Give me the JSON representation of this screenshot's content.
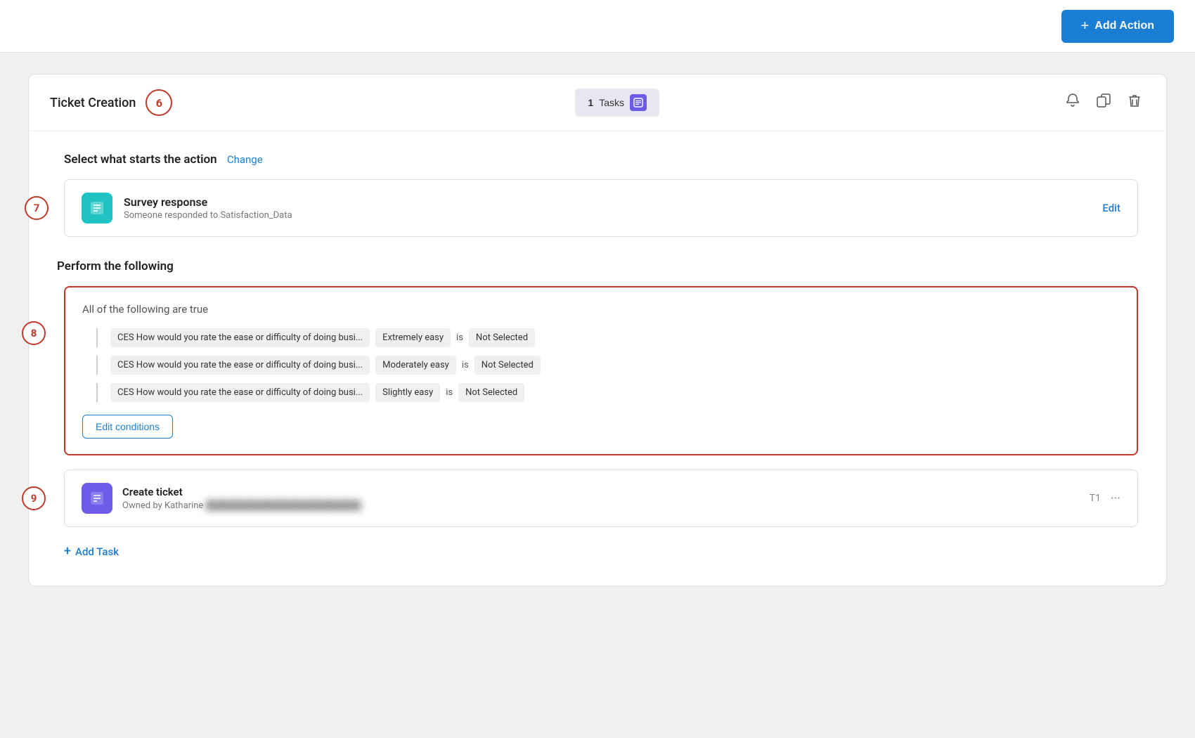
{
  "topbar": {
    "add_action_label": "Add Action"
  },
  "card": {
    "title": "Ticket Creation",
    "step_number": "6",
    "tasks_count": "1",
    "tasks_label": "Tasks"
  },
  "trigger_section": {
    "label": "Select what starts the action",
    "change_link": "Change",
    "trigger_name": "Survey response",
    "trigger_desc": "Someone responded to Satisfaction_Data",
    "edit_link": "Edit",
    "step_number": "7"
  },
  "perform_section": {
    "label": "Perform the following",
    "conditions_header": "All of the following are true",
    "step_number": "8",
    "conditions": [
      {
        "field": "CES How would you rate the ease or difficulty of doing busi...",
        "value": "Extremely easy",
        "op": "is",
        "status": "Not Selected"
      },
      {
        "field": "CES How would you rate the ease or difficulty of doing busi...",
        "value": "Moderately easy",
        "op": "is",
        "status": "Not Selected"
      },
      {
        "field": "CES How would you rate the ease or difficulty of doing busi...",
        "value": "Slightly easy",
        "op": "is",
        "status": "Not Selected"
      }
    ],
    "edit_conditions_label": "Edit conditions"
  },
  "action_row": {
    "step_number": "9",
    "action_name": "Create ticket",
    "action_desc": "Owned by Katharine",
    "task_id": "T1",
    "add_task_label": "Add Task"
  }
}
